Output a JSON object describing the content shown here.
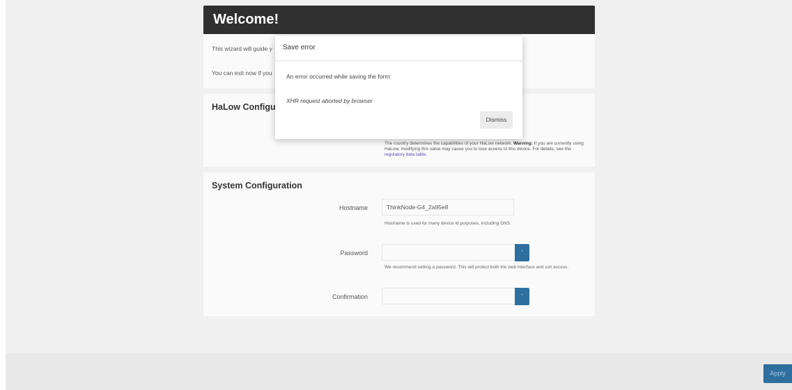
{
  "welcome": {
    "title": "Welcome!",
    "intro_line1": "This wizard will guide y",
    "intro_line2": "You can exit now if you"
  },
  "halow": {
    "title": "HaLow Configura",
    "description_pre": "The country determines the capabilities of your HaLow network. ",
    "warning_label": "Warning:",
    "description_post": " If you are currently using HaLow, modifying this value may cause you to lose access to this device. For details, see the ",
    "link_text": "regulatory data table",
    "description_end": "."
  },
  "system": {
    "title": "System Configuration",
    "hostname_label": "Hostname",
    "hostname_value": "ThinkNode-G4_2a95e8",
    "hostname_help": "Hostname is used for many device id purposes, including DNS.",
    "password_label": "Password",
    "password_help": "We recommend setting a password. This will protect both the web interface and ssh access.",
    "confirmation_label": "Confirmation",
    "reveal_glyph": "*"
  },
  "footer": {
    "apply_label": "Apply"
  },
  "modal": {
    "title": "Save error",
    "message": "An error occurred while saving the form:",
    "error": "XHR request aborted by browser",
    "dismiss_label": "Dismiss"
  },
  "colors": {
    "accent": "#2f6f9f",
    "header_bg": "#303030",
    "link": "#5b49b3"
  }
}
